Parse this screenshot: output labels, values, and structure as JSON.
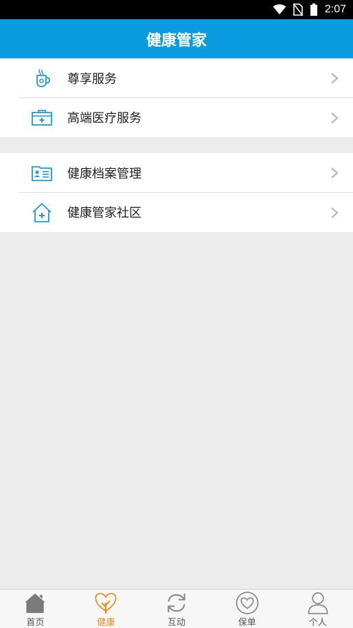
{
  "status_bar": {
    "time": "2:07"
  },
  "app_bar": {
    "title": "健康管家"
  },
  "groups": [
    {
      "items": [
        {
          "label": "尊享服务",
          "icon": "tea-cup-icon"
        },
        {
          "label": "高端医疗服务",
          "icon": "medical-kit-icon"
        }
      ]
    },
    {
      "items": [
        {
          "label": "健康档案管理",
          "icon": "health-record-icon"
        },
        {
          "label": "健康管家社区",
          "icon": "home-plus-icon"
        }
      ]
    }
  ],
  "bottom_nav": {
    "items": [
      {
        "label": "首页",
        "icon": "house-icon",
        "active": false
      },
      {
        "label": "健康",
        "icon": "heart-tree-icon",
        "active": true
      },
      {
        "label": "互动",
        "icon": "refresh-icon",
        "active": false
      },
      {
        "label": "保单",
        "icon": "heart-circle-icon",
        "active": false
      },
      {
        "label": "个人",
        "icon": "person-icon",
        "active": false
      }
    ]
  },
  "colors": {
    "brand": "#0a9be1",
    "active_tab": "#f08a1c",
    "icon_blue": "#1b9bd7",
    "background": "#ececec"
  }
}
